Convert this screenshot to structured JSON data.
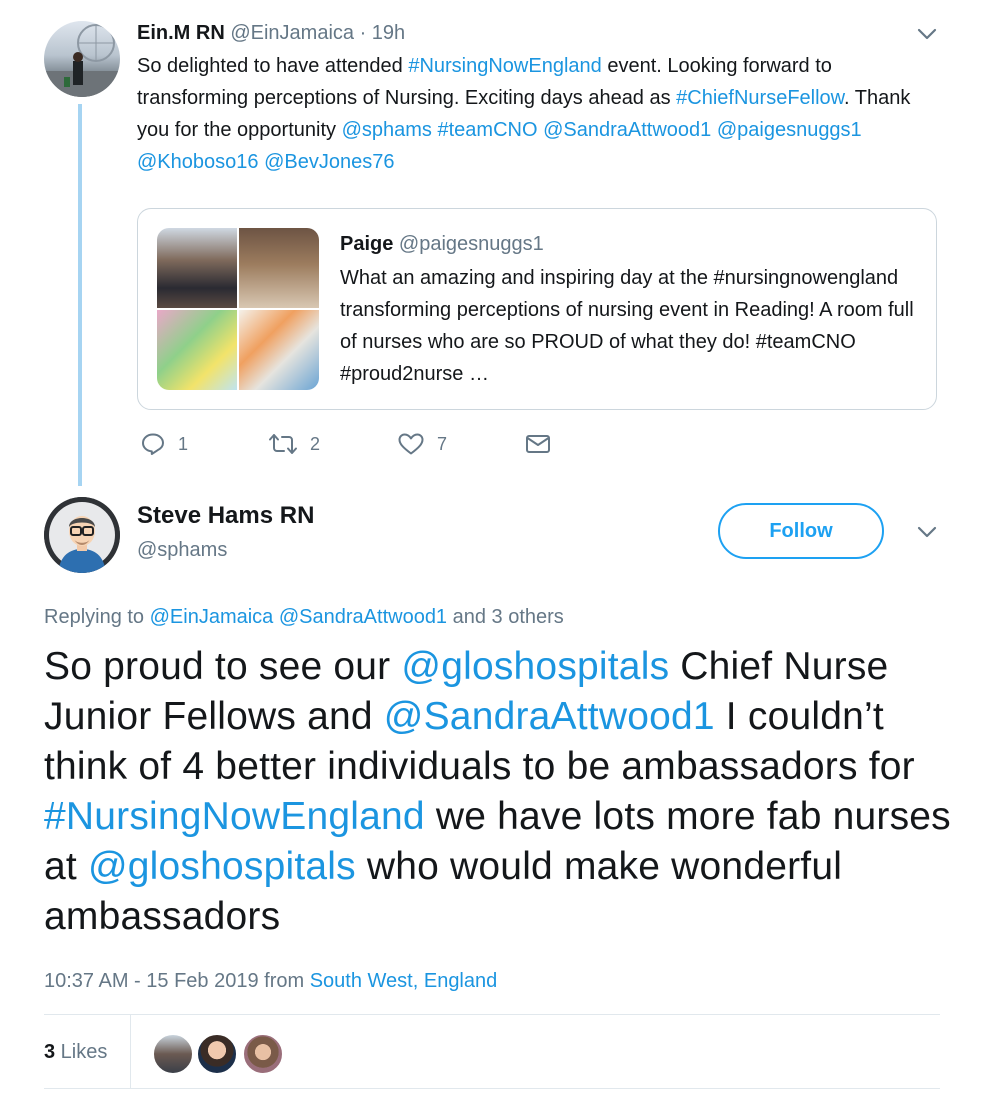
{
  "parent_tweet": {
    "name": "Ein.M RN",
    "handle": "@EinJamaica",
    "time": "· 19h",
    "text": {
      "t1": "So delighted to have attended ",
      "h1": "#NursingNowEngland",
      "t2": " event. Looking forward to transforming perceptions of Nursing. Exciting days ahead as ",
      "h2": "#ChiefNurseFellow",
      "t3": ". Thank you for the opportunity ",
      "m1": "@sphams",
      "h3": "#teamCNO",
      "m2": "@SandraAttwood1",
      "m3": "@paigesnuggs1",
      "m4": "@Khoboso16",
      "m5": "@BevJones76"
    },
    "quote": {
      "name": "Paige",
      "handle": "@paigesnuggs1",
      "text": "What an amazing and inspiring day at the #nursingnowengland transforming perceptions of nursing event in Reading! A room full of nurses who are so PROUD of what they do! #teamCNO #proud2nurse …"
    },
    "actions": {
      "replies": "1",
      "retweets": "2",
      "likes": "7"
    }
  },
  "main_tweet": {
    "name": "Steve Hams RN",
    "handle": "@sphams",
    "follow_label": "Follow",
    "replying": {
      "prefix": "Replying to ",
      "to1": "@EinJamaica",
      "to2": "@SandraAttwood1",
      "suffix": " and 3 others"
    },
    "text": {
      "t1": "So proud to see our ",
      "m1": "@gloshospitals",
      "t2": " Chief Nurse Junior Fellows and ",
      "m2": "@SandraAttwood1",
      "t3": " I couldn’t think of 4 better individuals to be ambassadors for ",
      "h1": "#NursingNowEngland",
      "t4": " we have lots more fab nurses at ",
      "m3": "@gloshospitals",
      "t5": " who would make wonderful ambassadors"
    },
    "timestamp": "10:37 AM - 15 Feb 2019",
    "from_prefix": " from ",
    "location": "South West, England",
    "likes_count": "3",
    "likes_label": " Likes"
  },
  "icons": [
    "chevron-down-icon",
    "reply-icon",
    "retweet-icon",
    "heart-icon",
    "direct-message-icon"
  ],
  "colors": {
    "link": "#1b95e0",
    "follow": "#1da1f2",
    "thread_line": "#a6d4f2",
    "muted": "#657786"
  }
}
